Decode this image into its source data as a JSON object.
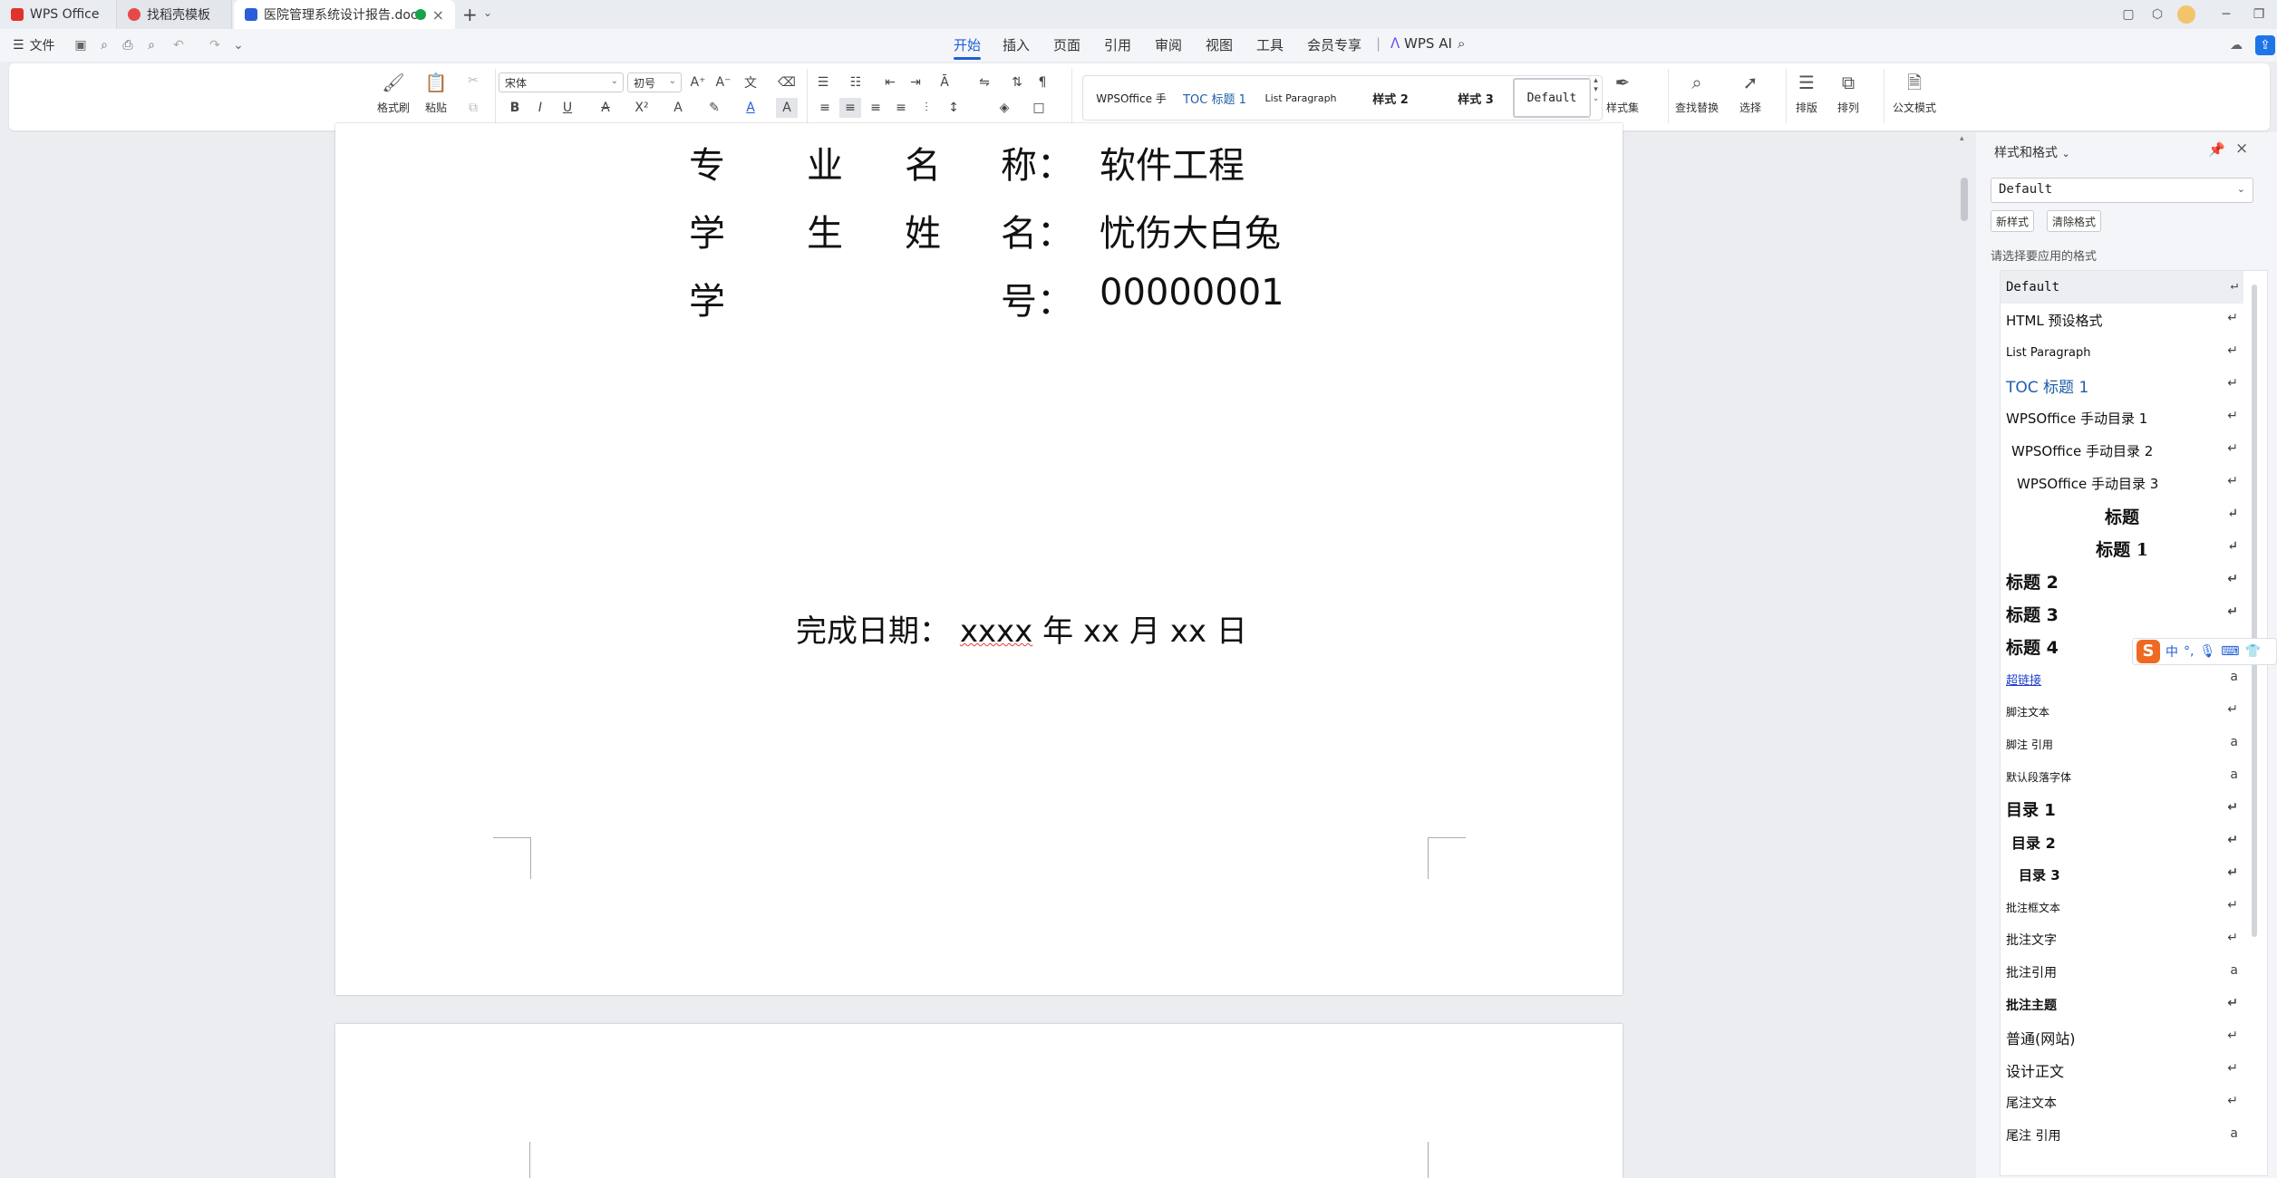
{
  "tabs": [
    {
      "label": "WPS Office",
      "icon": "wps-logo-icon"
    },
    {
      "label": "找稻壳模板",
      "icon": "docer-icon"
    },
    {
      "label": "医院管理系统设计报告.docx",
      "icon": "word-doc-icon",
      "active": true
    }
  ],
  "menubar": {
    "file_label": "文件",
    "tabs": [
      "开始",
      "插入",
      "页面",
      "引用",
      "审阅",
      "视图",
      "工具",
      "会员专享"
    ],
    "wps_ai": "WPS AI",
    "active": "开始"
  },
  "ribbon": {
    "format_painter": "格式刷",
    "paste": "粘贴",
    "font_name": "宋体",
    "font_size": "初号",
    "styles_set": "样式集",
    "find_replace": "查找替换",
    "select": "选择",
    "layout": "排版",
    "arrange": "排列",
    "official_mode": "公文模式",
    "gallery": [
      "WPSOffice 手",
      "TOC 标题 1",
      "List Paragraph",
      "样式 2",
      "样式 3",
      "Default"
    ]
  },
  "document": {
    "major_label": [
      "专",
      "业",
      "名",
      "称："
    ],
    "major_value": "软件工程",
    "student_label": [
      "学",
      "生",
      "姓",
      "名："
    ],
    "student_value": "忧伤大白兔",
    "id_label": [
      "学",
      "号："
    ],
    "id_value": "00000001",
    "date_label": "完成日期：",
    "date_year": "xxxx",
    "date_rest": " 年  xx 月 xx 日"
  },
  "style_pane": {
    "title": "样式和格式",
    "current": "Default",
    "new_style": "新样式",
    "clear_format": "清除格式",
    "hint": "请选择要应用的格式",
    "items": [
      {
        "label": "Default",
        "mark": "↵",
        "active": true
      },
      {
        "label": "HTML 预设格式",
        "mark": "↵"
      },
      {
        "label": "List Paragraph",
        "mark": "↵"
      },
      {
        "label": "TOC 标题 1",
        "mark": "↵"
      },
      {
        "label": "WPSOffice 手动目录 1",
        "mark": "↵"
      },
      {
        "label": "WPSOffice 手动目录 2",
        "mark": "↵"
      },
      {
        "label": "WPSOffice 手动目录 3",
        "mark": "↵"
      },
      {
        "label": "标题",
        "mark": "↵"
      },
      {
        "label": "标题 1",
        "mark": "↵"
      },
      {
        "label": "标题 2",
        "mark": "↵"
      },
      {
        "label": "标题 3",
        "mark": "↵"
      },
      {
        "label": "标题 4",
        "mark": "↵"
      },
      {
        "label": "超链接",
        "mark": "a"
      },
      {
        "label": "脚注文本",
        "mark": "↵"
      },
      {
        "label": "脚注 引用",
        "mark": "a"
      },
      {
        "label": "默认段落字体",
        "mark": "a"
      },
      {
        "label": "目录 1",
        "mark": "↵"
      },
      {
        "label": "目录 2",
        "mark": "↵"
      },
      {
        "label": "目录 3",
        "mark": "↵"
      },
      {
        "label": "批注框文本",
        "mark": "↵"
      },
      {
        "label": "批注文字",
        "mark": "↵"
      },
      {
        "label": "批注引用",
        "mark": "a"
      },
      {
        "label": "批注主题",
        "mark": "↵"
      },
      {
        "label": "普通(网站)",
        "mark": "↵"
      },
      {
        "label": "设计正文",
        "mark": "↵"
      },
      {
        "label": "尾注文本",
        "mark": "↵"
      },
      {
        "label": "尾注 引用",
        "mark": "a"
      }
    ]
  },
  "ime": {
    "lang": "中",
    "punct": "°,"
  }
}
